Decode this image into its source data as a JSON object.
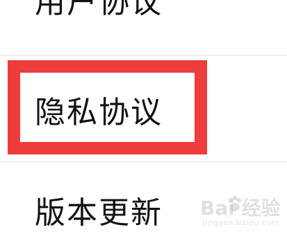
{
  "menu": {
    "items": [
      {
        "label": "用户协议"
      },
      {
        "label": "隐私协议"
      },
      {
        "label": "版本更新"
      }
    ]
  },
  "highlight": {
    "target": "隐私协议",
    "color": "#ee3b3b"
  },
  "watermark": {
    "brand": "Bai 经验",
    "url": "jingyan.baidu.com"
  }
}
